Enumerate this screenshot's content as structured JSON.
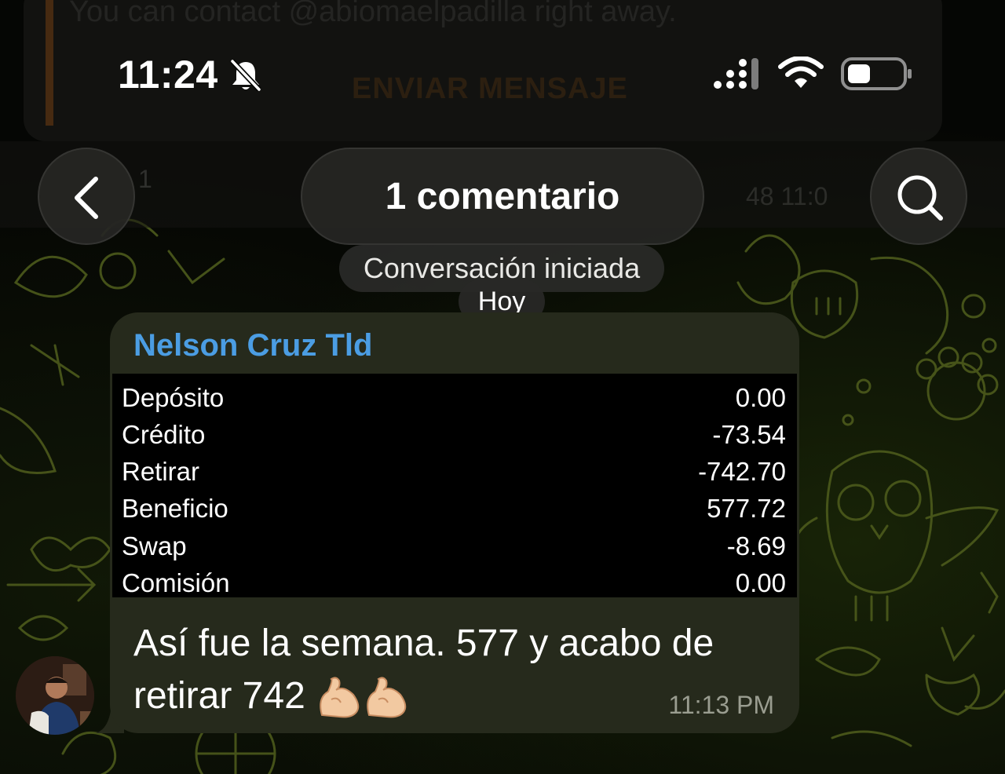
{
  "status_bar": {
    "time": "11:24",
    "icons": [
      "bell-slash-icon",
      "cellular-signal-icon",
      "wifi-icon",
      "battery-icon"
    ]
  },
  "background_ghost": {
    "text": "You can contact @abiomaelpadilla right away.",
    "button": "ENVIAR MENSAJE",
    "comments": "1",
    "meta": "48 11:0"
  },
  "header": {
    "back_icon": "chevron-left-icon",
    "title": "1 comentario",
    "search_icon": "search-icon"
  },
  "service_message": "Conversación iniciada",
  "date_separator": "Hoy",
  "message": {
    "sender": "Nelson Cruz Tld",
    "stats": [
      {
        "label": "Depósito",
        "value": "0.00"
      },
      {
        "label": "Crédito",
        "value": "-73.54"
      },
      {
        "label": "Retirar",
        "value": "-742.70"
      },
      {
        "label": "Beneficio",
        "value": "577.72"
      },
      {
        "label": "Swap",
        "value": "-8.69"
      },
      {
        "label": "Comisión",
        "value": "0.00"
      }
    ],
    "text_line1": "Así fue la semana. 577 y acabo de",
    "text_line2": "retirar 742",
    "emoji": "flexed-biceps-icon",
    "time": "11:13 PM"
  },
  "colors": {
    "sender": "#4b9de3",
    "bubble": "#262a1c",
    "doodle": "#4c5a1c"
  }
}
